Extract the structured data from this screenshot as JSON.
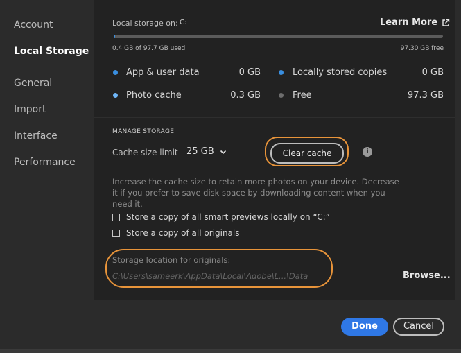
{
  "sidebar": {
    "items": [
      {
        "label": "Account"
      },
      {
        "label": "Local Storage"
      },
      {
        "label": "General"
      },
      {
        "label": "Import"
      },
      {
        "label": "Interface"
      },
      {
        "label": "Performance"
      }
    ],
    "active": "Local Storage"
  },
  "storage": {
    "label": "Local storage on:",
    "drive": "C:",
    "learn_more": "Learn More",
    "used_text": "0.4 GB of 97.7 GB used",
    "free_text": "97.30 GB free",
    "used_fraction": 0.004,
    "bar_color": "#3a8fe0",
    "legend": [
      {
        "label": "App & user data",
        "value": "0 GB",
        "color": "#3a8fe0"
      },
      {
        "label": "Locally stored copies",
        "value": "0 GB",
        "color": "#3a8fe0"
      },
      {
        "label": "Photo cache",
        "value": "0.3 GB",
        "color": "#6fb6f7"
      },
      {
        "label": "Free",
        "value": "97.3 GB",
        "color": "#6d6d6d"
      }
    ]
  },
  "manage": {
    "title": "MANAGE STORAGE",
    "cache_label": "Cache size limit",
    "cache_value": "25 GB",
    "clear_cache": "Clear cache",
    "description": "Increase the cache size to retain more photos on your device. Decrease it if you prefer to save disk space by downloading content when you need it.",
    "checkbox_previews": "Store a copy of all smart previews locally on “C:”",
    "checkbox_originals": "Store a copy of all originals",
    "location_label": "Storage location for originals:",
    "location_path": "C:\\Users\\sameerk\\AppData\\Local\\Adobe\\L...\\Data",
    "browse": "Browse..."
  },
  "footer": {
    "done": "Done",
    "cancel": "Cancel"
  },
  "colors": {
    "highlight": "#e8943a",
    "primary": "#2f78e6"
  }
}
